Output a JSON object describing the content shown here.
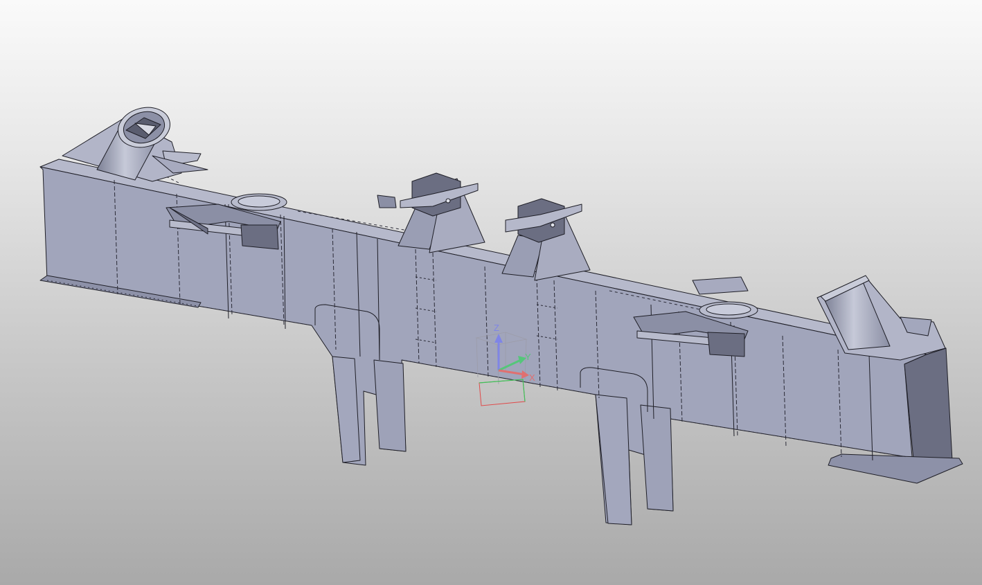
{
  "viewport": {
    "background_top": "#fafafa",
    "background_bottom": "#a9a9a9",
    "part_color": "#a1a5bb",
    "part_dark": "#6b6e82",
    "edge_color": "#1e1e26"
  },
  "triad": {
    "z_label": "Z",
    "x_label": "X",
    "y_label": "Y",
    "z_color": "#7f85e6",
    "x_color": "#e07070",
    "y_color": "#55c67a"
  },
  "icons": [
    "compass-triad-icon"
  ]
}
